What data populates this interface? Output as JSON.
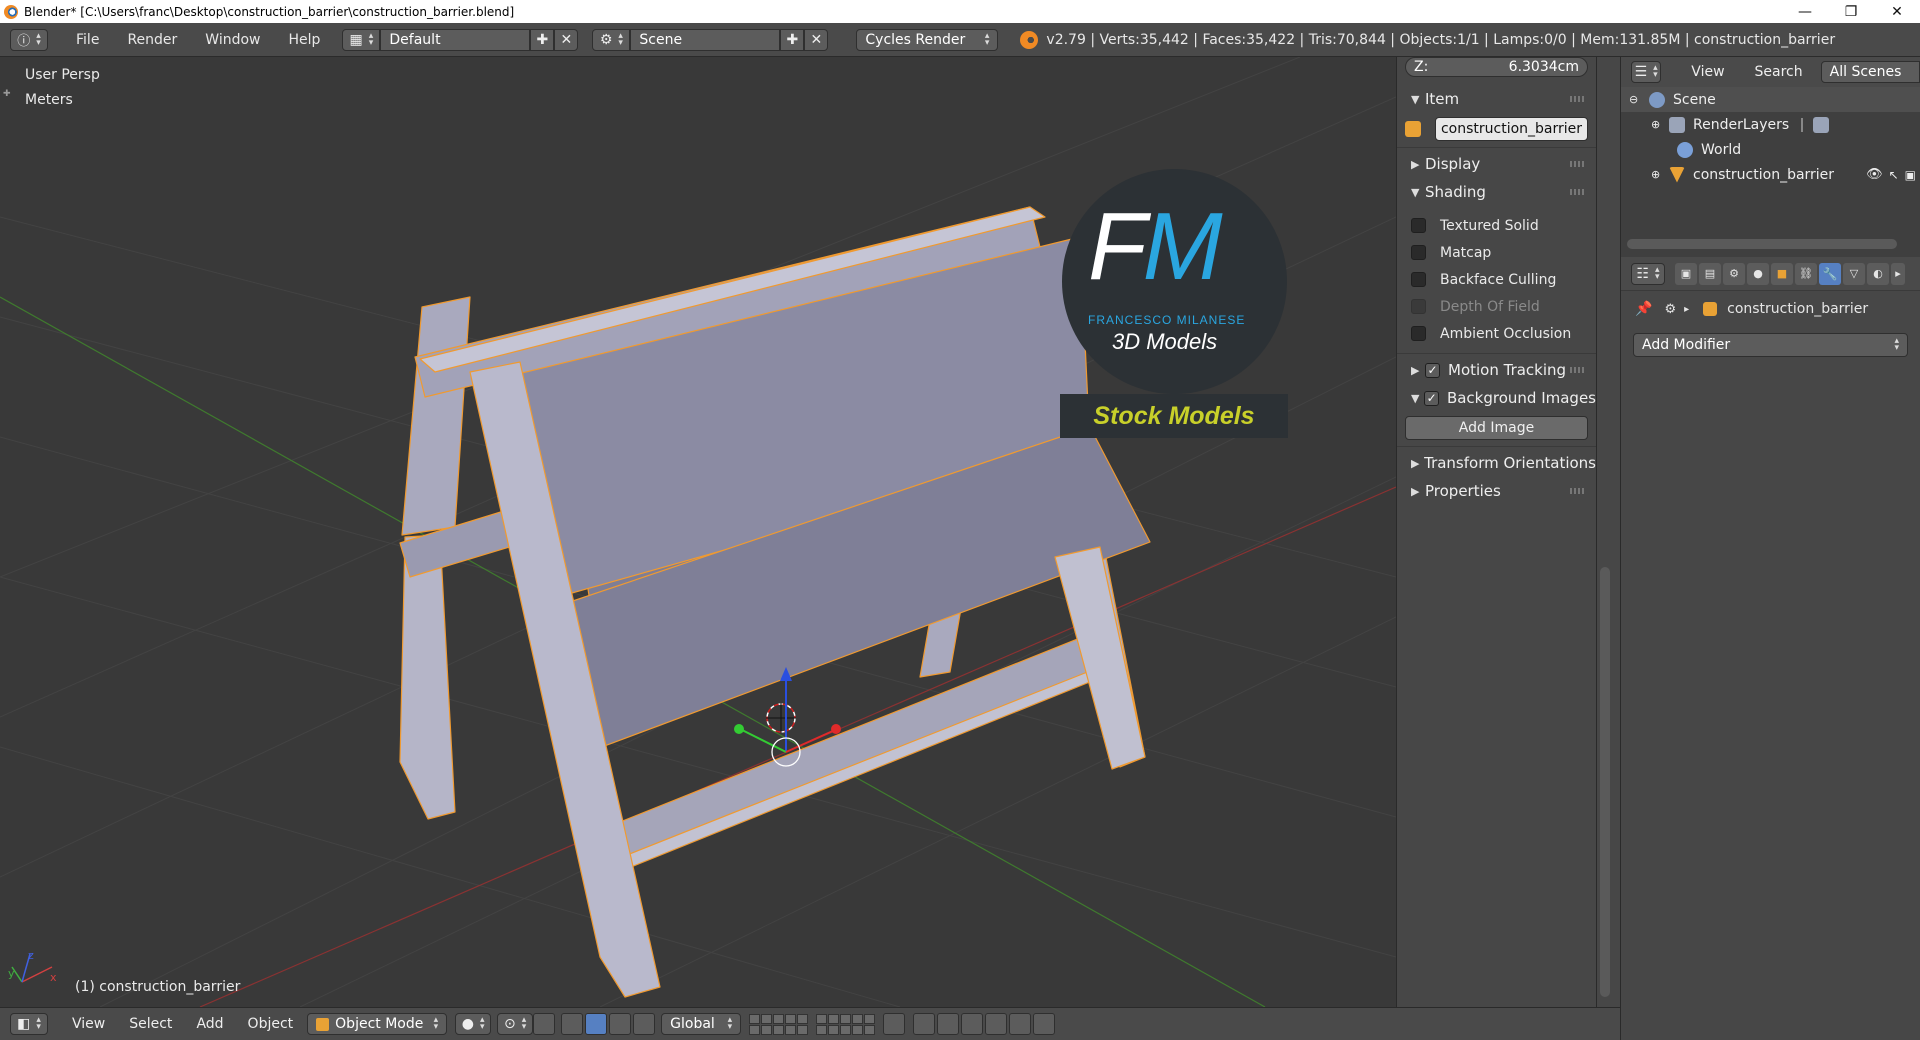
{
  "window": {
    "title": "Blender* [C:\\Users\\franc\\Desktop\\construction_barrier\\construction_barrier.blend]",
    "controls": {
      "minimize": "—",
      "maximize": "❐",
      "close": "✕"
    }
  },
  "info_header": {
    "menus": [
      "File",
      "Render",
      "Window",
      "Help"
    ],
    "screen_layout": "Default",
    "scene": "Scene",
    "render_engine": "Cycles Render",
    "stats": "v2.79 | Verts:35,442 | Faces:35,422 | Tris:70,844 | Objects:1/1 | Lamps:0/0 | Mem:131.85M | construction_barrier"
  },
  "viewport": {
    "view_name": "User Persp",
    "units": "Meters",
    "object_label": "(1) construction_barrier",
    "watermark": {
      "logo_letters_f": "F",
      "logo_letters_m": "M",
      "author": "FRANCESCO MILANESE",
      "subtitle": "3D Models",
      "banner": "Stock Models"
    },
    "axis_labels": {
      "x": "x",
      "y": "y",
      "z": "z"
    }
  },
  "n_panel": {
    "z_field_label": "Z:",
    "z_field_value": "6.3034cm",
    "item_header": "Item",
    "item_name": "construction_barrier",
    "display_header": "Display",
    "shading_header": "Shading",
    "shading_options": [
      {
        "label": "Textured Solid",
        "checked": false,
        "disabled": false
      },
      {
        "label": "Matcap",
        "checked": false,
        "disabled": false
      },
      {
        "label": "Backface Culling",
        "checked": false,
        "disabled": false
      },
      {
        "label": "Depth Of Field",
        "checked": false,
        "disabled": true
      },
      {
        "label": "Ambient Occlusion",
        "checked": false,
        "disabled": false
      }
    ],
    "motion_tracking": "Motion Tracking",
    "background_images": "Background Images",
    "add_image": "Add Image",
    "transform_orientations": "Transform Orientations",
    "properties": "Properties"
  },
  "outliner": {
    "menu_view": "View",
    "menu_search": "Search",
    "display_mode": "All Scenes",
    "tree": [
      {
        "label": "Scene",
        "icon": "scene-icon"
      },
      {
        "label": "RenderLayers",
        "icon": "renderlayers-icon"
      },
      {
        "label": "World",
        "icon": "world-icon"
      },
      {
        "label": "construction_barrier",
        "icon": "mesh-object-icon"
      }
    ]
  },
  "properties_editor": {
    "context_object": "construction_barrier",
    "add_modifier": "Add Modifier"
  },
  "bottom_header": {
    "menus": [
      "View",
      "Select",
      "Add",
      "Object"
    ],
    "mode": "Object Mode",
    "orientation": "Global"
  },
  "colors": {
    "accent_blue": "#5680c2",
    "selection_orange": "#f09a30",
    "logo_blue": "#2aa6e0",
    "banner_yellow": "#c8d02a",
    "mesh_gray": "#8e8ea8"
  }
}
